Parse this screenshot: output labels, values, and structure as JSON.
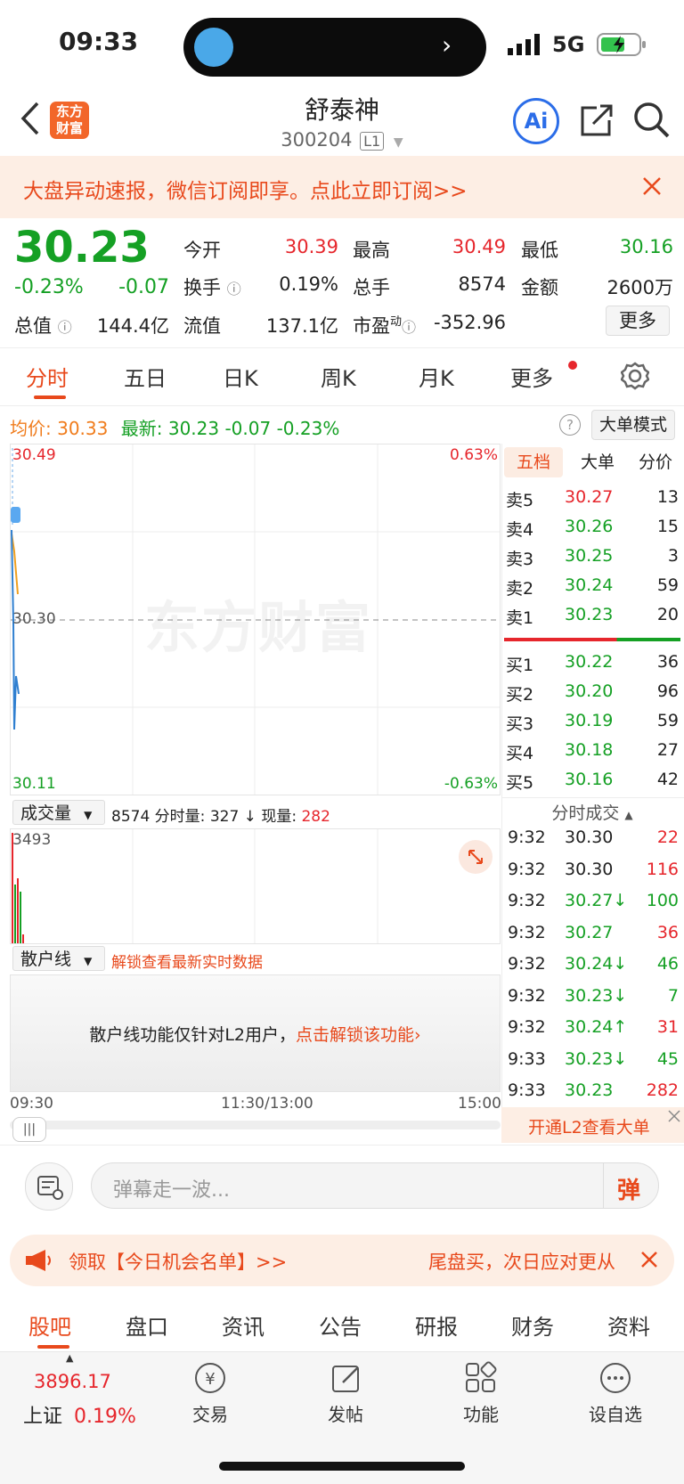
{
  "status_bar": {
    "time": "09:33",
    "network": "5G"
  },
  "header": {
    "name": "舒泰神",
    "code": "300204",
    "level_badge": "L1",
    "logo_text": "东方财富",
    "ai_label": "Ai"
  },
  "banner": {
    "text": "大盘异动速报，微信订阅即享。点此立即订阅>>"
  },
  "quote": {
    "price": "30.23",
    "change_pct": "-0.23%",
    "change": "-0.07",
    "open_label": "今开",
    "open": "30.39",
    "high_label": "最高",
    "high": "30.49",
    "low_label": "最低",
    "low": "30.16",
    "turnover_label": "换手",
    "turnover": "0.19%",
    "volume_label": "总手",
    "volume": "8574",
    "amount_label": "金额",
    "amount": "2600万",
    "mcap_label": "总值",
    "mcap": "144.4亿",
    "float_label": "流值",
    "float": "137.1亿",
    "pe_label": "市盈",
    "pe_sup": "动",
    "pe": "-352.96",
    "more_label": "更多"
  },
  "chart_tabs": [
    "分时",
    "五日",
    "日K",
    "周K",
    "月K",
    "更多"
  ],
  "info_line": {
    "avg_label": "均价:",
    "avg": "30.33",
    "latest_label": "最新:",
    "latest": "30.23",
    "chg": "-0.07",
    "pct": "-0.23%",
    "mode_label": "大单模式"
  },
  "chart": {
    "top_price": "30.49",
    "mid_price": "30.30",
    "bottom_price": "30.11",
    "top_pct": "0.63%",
    "bottom_pct": "-0.63%",
    "watermark": "东方财富",
    "time_start": "09:30",
    "time_mid": "11:30/13:00",
    "time_end": "15:00"
  },
  "volume": {
    "selector": "成交量",
    "total": "8574",
    "seg_label": "分时量:",
    "seg": "327",
    "cur_label": "现量:",
    "cur": "282",
    "max": "3493"
  },
  "retail": {
    "selector": "散户线",
    "unlock_hint": "解锁查看最新实时数据",
    "note": "散户线功能仅针对L2用户，",
    "note_link": "点击解锁该功能"
  },
  "orderbook": {
    "tabs": [
      "五档",
      "大单",
      "分价"
    ],
    "sells": [
      {
        "label": "卖5",
        "price": "30.27",
        "vol": "13"
      },
      {
        "label": "卖4",
        "price": "30.26",
        "vol": "15"
      },
      {
        "label": "卖3",
        "price": "30.25",
        "vol": "3"
      },
      {
        "label": "卖2",
        "price": "30.24",
        "vol": "59"
      },
      {
        "label": "卖1",
        "price": "30.23",
        "vol": "20"
      }
    ],
    "buys": [
      {
        "label": "买1",
        "price": "30.22",
        "vol": "36"
      },
      {
        "label": "买2",
        "price": "30.20",
        "vol": "96"
      },
      {
        "label": "买3",
        "price": "30.19",
        "vol": "59"
      },
      {
        "label": "买4",
        "price": "30.18",
        "vol": "27"
      },
      {
        "label": "买5",
        "price": "30.16",
        "vol": "42"
      }
    ]
  },
  "trades": {
    "title": "分时成交",
    "rows": [
      {
        "time": "9:32",
        "price": "30.30",
        "vol": "22",
        "pc": "#222",
        "vc": "#e6262c"
      },
      {
        "time": "9:32",
        "price": "30.30",
        "vol": "116",
        "pc": "#222",
        "vc": "#e6262c"
      },
      {
        "time": "9:32",
        "price": "30.27↓",
        "vol": "100",
        "pc": "#15a024",
        "vc": "#15a024"
      },
      {
        "time": "9:32",
        "price": "30.27",
        "vol": "36",
        "pc": "#15a024",
        "vc": "#e6262c"
      },
      {
        "time": "9:32",
        "price": "30.24↓",
        "vol": "46",
        "pc": "#15a024",
        "vc": "#15a024"
      },
      {
        "time": "9:32",
        "price": "30.23↓",
        "vol": "7",
        "pc": "#15a024",
        "vc": "#15a024"
      },
      {
        "time": "9:32",
        "price": "30.24↑",
        "vol": "31",
        "pc": "#15a024",
        "vc": "#e6262c"
      },
      {
        "time": "9:33",
        "price": "30.23↓",
        "vol": "45",
        "pc": "#15a024",
        "vc": "#15a024"
      },
      {
        "time": "9:33",
        "price": "30.23",
        "vol": "282",
        "pc": "#15a024",
        "vc": "#e6262c"
      }
    ],
    "l2_label": "开通L2查看大单"
  },
  "danmu": {
    "placeholder": "弹幕走一波...",
    "send": "弹"
  },
  "promo": {
    "left": "领取【今日机会名单】>>",
    "right": "尾盘买，次日应对更从"
  },
  "bottom_tabs": [
    "股吧",
    "盘口",
    "资讯",
    "公告",
    "研报",
    "财务",
    "资料"
  ],
  "nav": {
    "index_value": "3896.17",
    "index_name": "上证",
    "index_pct": "0.19%",
    "trade": "交易",
    "post": "发帖",
    "func": "功能",
    "watch": "设自选"
  },
  "colors": {
    "up": "#e6262c",
    "down": "#15a024",
    "accent": "#f07c1c",
    "avg_line": "#f0a020",
    "price_line": "#2f7fd0"
  }
}
